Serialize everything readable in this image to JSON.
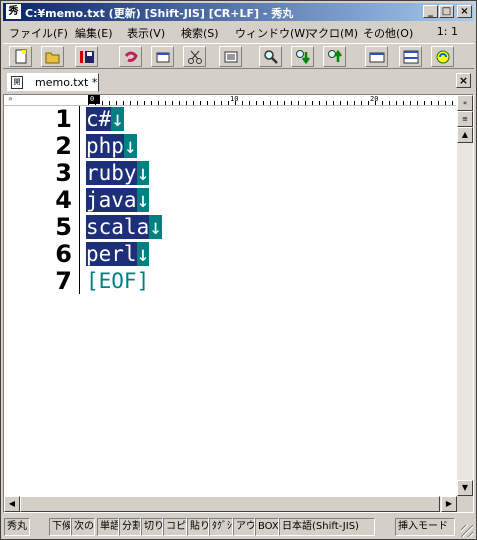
{
  "window": {
    "title": "C:¥memo.txt (更新) [Shift-JIS] [CR+LF] - 秀丸",
    "app_icon": "秀",
    "minimize": "_",
    "maximize": "□",
    "close": "×"
  },
  "menu": {
    "items": [
      "ファイル(F)",
      "編集(E)",
      "表示(V)",
      "検索(S)",
      "ウィンドウ(W)",
      "マクロ(M)",
      "その他(O)"
    ],
    "position": "1:   1"
  },
  "toolbar": {
    "icons": [
      "new-file-icon",
      "open-folder-icon",
      "save-icon",
      "undo-icon",
      "copy-window-icon",
      "cut-icon",
      "paste-icon",
      "find-icon",
      "find-down-icon",
      "find-up-icon",
      "window-icon",
      "split-icon",
      "help-icon"
    ]
  },
  "tab": {
    "label": "memo.txt *",
    "icon": "開",
    "close": "×"
  },
  "ruler": {
    "marks": [
      "0",
      "10",
      "20"
    ],
    "left_glyph": "»"
  },
  "editor": {
    "line_numbers": [
      "1",
      "2",
      "3",
      "4",
      "5",
      "6",
      "7"
    ],
    "lines": [
      "c#",
      "php",
      "ruby",
      "java",
      "scala",
      "perl"
    ],
    "newline_glyph": "↓",
    "eof": "[EOF]"
  },
  "statusbar": {
    "items": [
      "秀丸",
      "下候",
      "次の",
      "単語",
      "分割",
      "切り",
      "コピー",
      "貼り",
      "ﾀｸﾞｼﾞ",
      "アウト",
      "BOX",
      "日本語(Shift-JIS)",
      "挿入モード"
    ]
  }
}
